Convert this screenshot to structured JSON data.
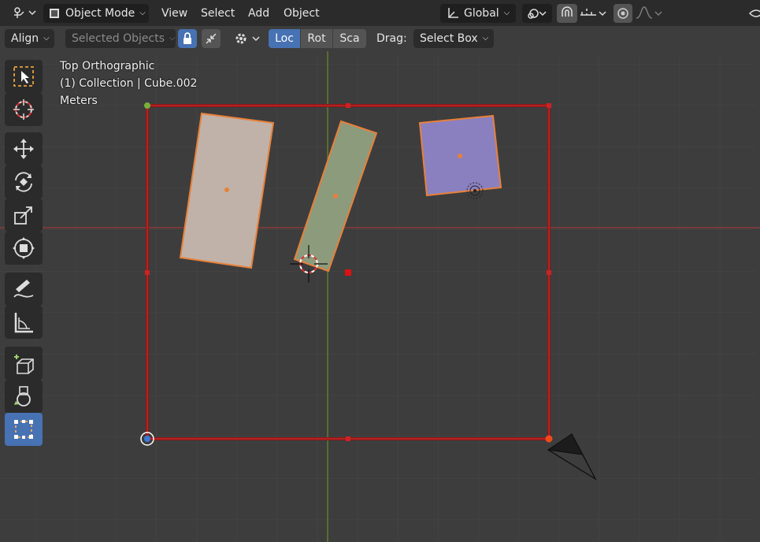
{
  "header": {
    "mode_label": "Object Mode",
    "menus": [
      "View",
      "Select",
      "Add",
      "Object"
    ],
    "orientation_label": "Global"
  },
  "tool_header": {
    "align_label": "Align",
    "selected_label": "Selected Objects",
    "loc": "Loc",
    "rot": "Rot",
    "sca": "Sca",
    "drag_label": "Drag:",
    "drag_value": "Select Box"
  },
  "overlay": {
    "view_name": "Top Orthographic",
    "collection": "(1) Collection | Cube.002",
    "units": "Meters"
  },
  "colors": {
    "accent": "#4772b3",
    "selection": "#e8803a",
    "bounds": "#b01c1c",
    "x_axis": "#9b3a3a",
    "y_axis": "#6a8a2a",
    "cube_left": "#c0b2a8",
    "cube_middle": "#8c9b7c",
    "cube_right": "#8a80c0"
  },
  "icons": {
    "editor_type": "editor-type-icon",
    "mode": "object-mode-icon",
    "transform_orientation": "orientation-axes-icon",
    "pivot": "pivot-point-icon",
    "snap": "snap-magnet-icon",
    "snap_target": "snap-increment-icon",
    "proportional": "proportional-edit-icon",
    "falloff": "falloff-curve-icon",
    "lock": "lock-icon",
    "affect_only": "affect-only-origins-icon",
    "options": "gear-icon"
  }
}
